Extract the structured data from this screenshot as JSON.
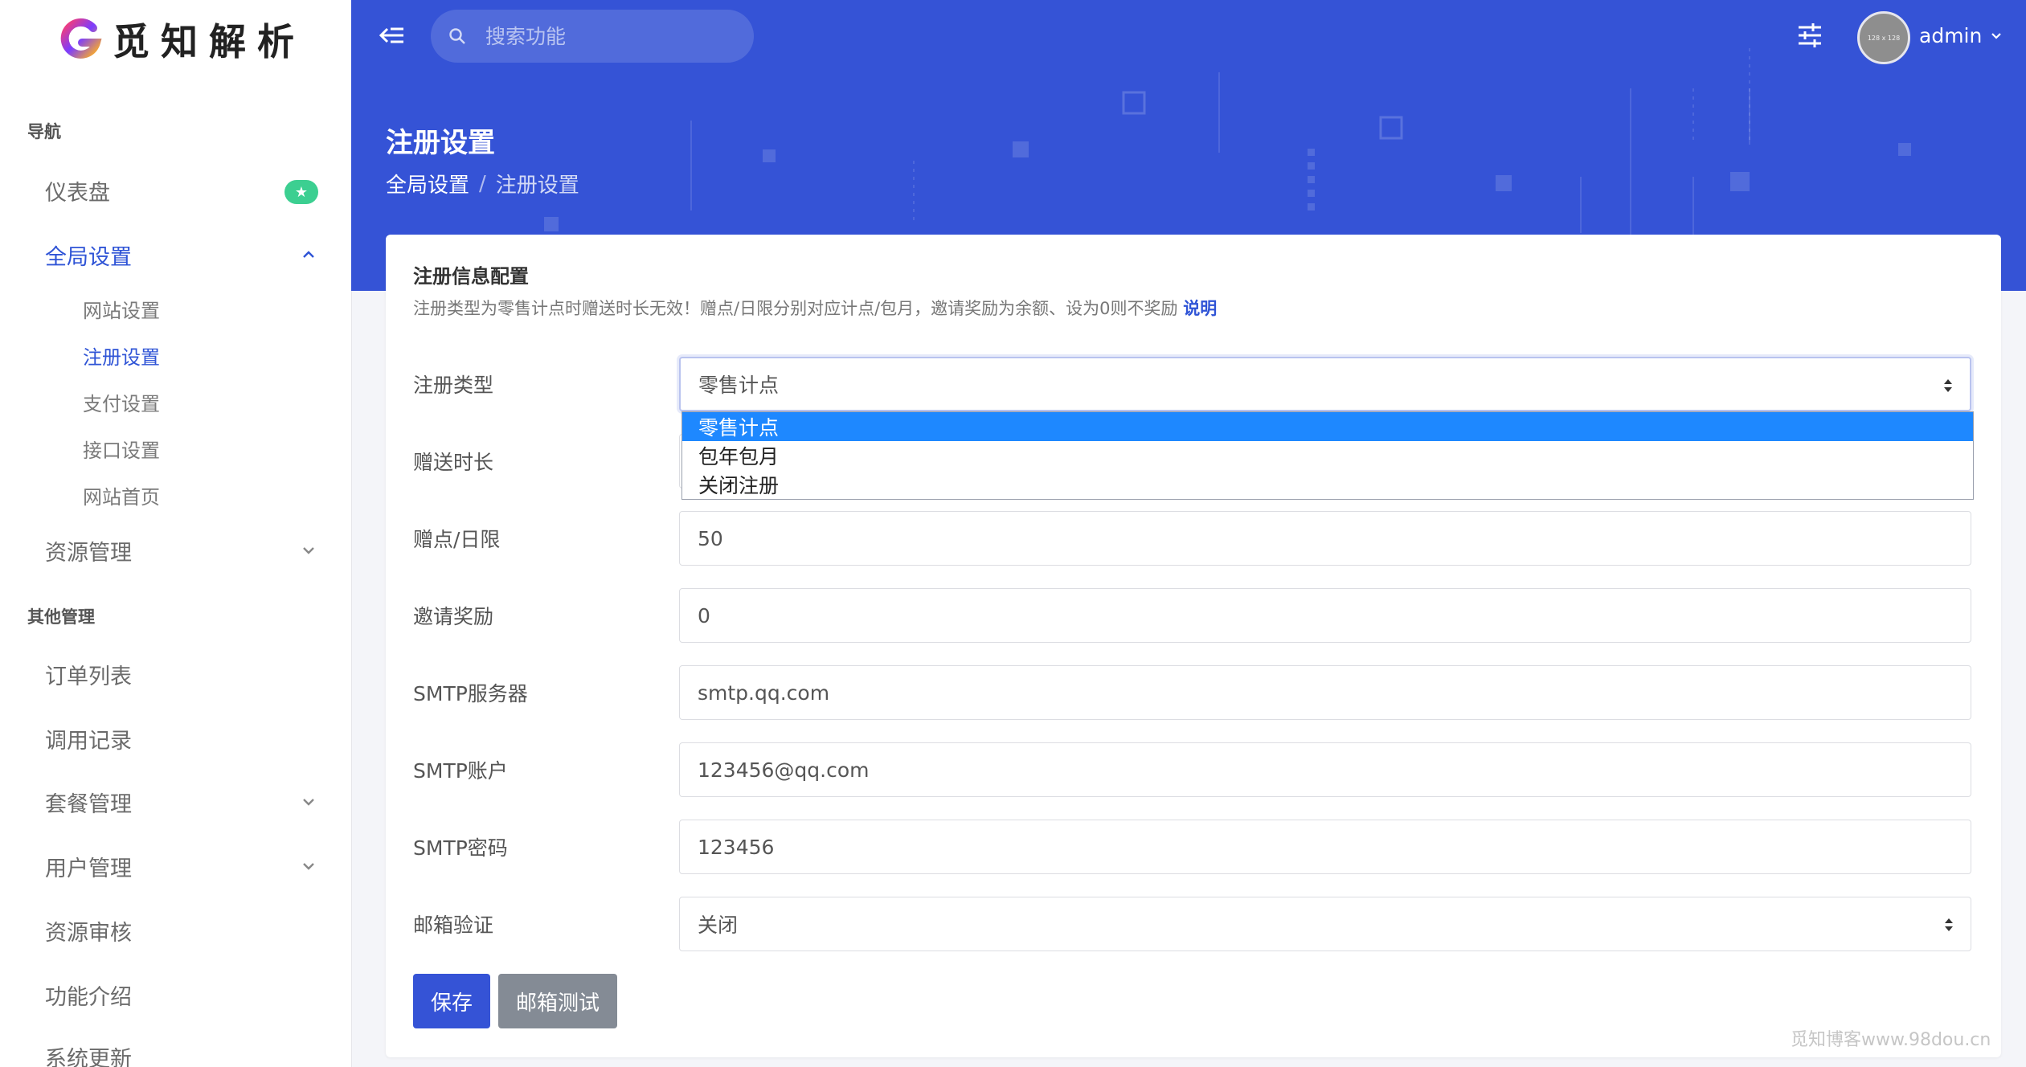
{
  "app": {
    "logo_text": "觅知解析",
    "watermark": "觅知博客www.98dou.cn"
  },
  "colors": {
    "accent": "#3553d6",
    "badge": "#3ccf91",
    "option_highlight": "#1e88ff"
  },
  "sidebar": {
    "section_nav": "导航",
    "section_other": "其他管理",
    "items": [
      {
        "label": "仪表盘",
        "badge": "★",
        "icon": "star-icon"
      },
      {
        "label": "全局设置",
        "expanded": true
      },
      {
        "label": "资源管理"
      },
      {
        "label": "订单列表"
      },
      {
        "label": "调用记录"
      },
      {
        "label": "套餐管理"
      },
      {
        "label": "用户管理"
      },
      {
        "label": "资源审核"
      },
      {
        "label": "功能介绍"
      },
      {
        "label": "系统更新"
      }
    ],
    "subitems": [
      {
        "label": "网站设置"
      },
      {
        "label": "注册设置",
        "active": true
      },
      {
        "label": "支付设置"
      },
      {
        "label": "接口设置"
      },
      {
        "label": "网站首页"
      }
    ]
  },
  "header": {
    "search_placeholder": "搜索功能",
    "avatar_text": "128 x 128",
    "username": "admin",
    "page_title": "注册设置",
    "breadcrumb": [
      "全局设置",
      "注册设置"
    ]
  },
  "card": {
    "title": "注册信息配置",
    "description": "注册类型为零售计点时赠送时长无效！赠点/日限分别对应计点/包月，邀请奖励为余额、设为0则不奖励",
    "description_link": "说明",
    "fields": {
      "reg_type": {
        "label": "注册类型",
        "value": "零售计点",
        "options": [
          "零售计点",
          "包年包月",
          "关闭注册"
        ]
      },
      "gift_duration": {
        "label": "赠送时长",
        "value": ""
      },
      "gift_points": {
        "label": "赠点/日限",
        "value": "50"
      },
      "invite_reward": {
        "label": "邀请奖励",
        "value": "0"
      },
      "smtp_server": {
        "label": "SMTP服务器",
        "value": "smtp.qq.com"
      },
      "smtp_account": {
        "label": "SMTP账户",
        "value": "123456@qq.com"
      },
      "smtp_password": {
        "label": "SMTP密码",
        "value": "123456"
      },
      "email_verify": {
        "label": "邮箱验证",
        "value": "关闭"
      }
    },
    "buttons": {
      "save": "保存",
      "test": "邮箱测试"
    }
  }
}
